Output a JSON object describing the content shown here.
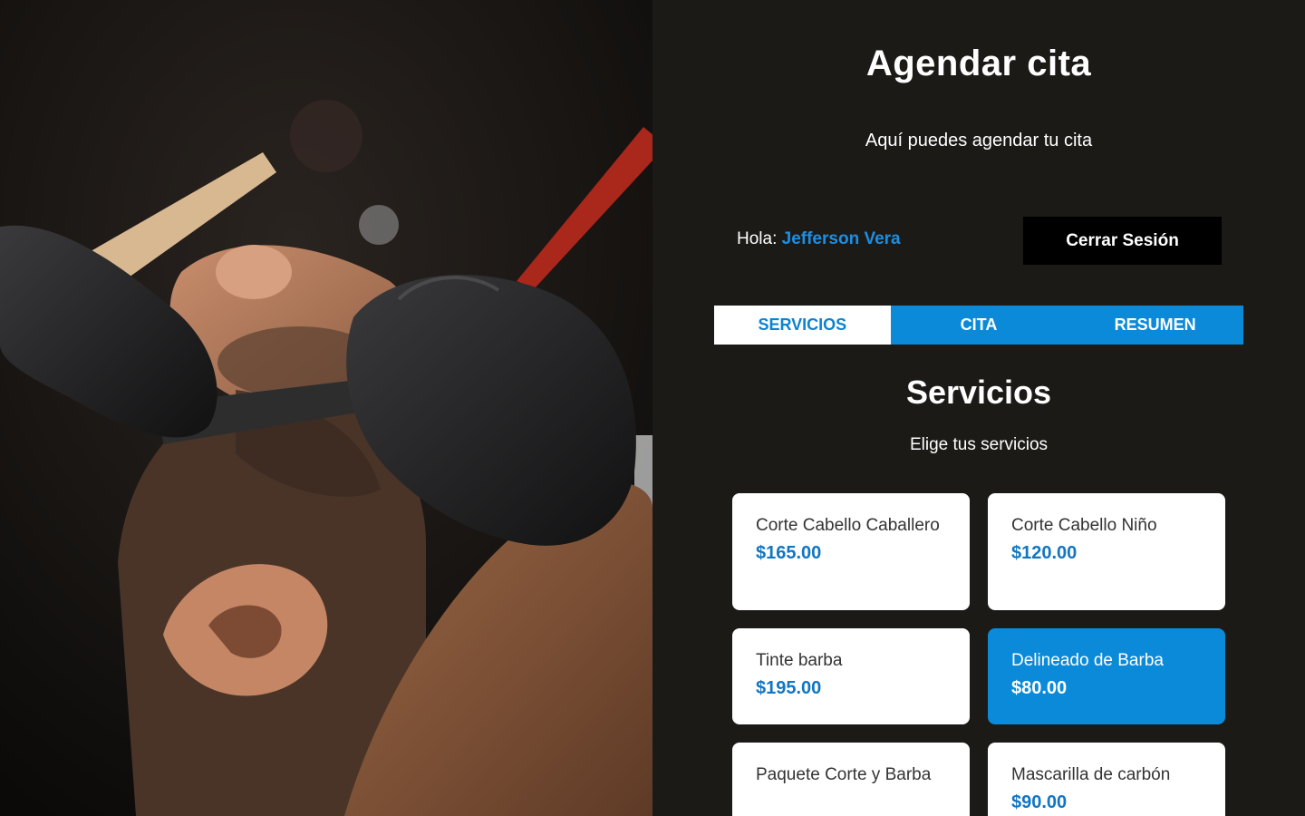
{
  "app": {
    "title": "Agendar cita",
    "subtitle": "Aquí puedes agendar tu cita"
  },
  "user": {
    "greeting_label": "Hola:",
    "name": "Jefferson Vera",
    "logout_label": "Cerrar Sesión"
  },
  "tabs": [
    {
      "label": "Servicios",
      "active": true
    },
    {
      "label": "Cita",
      "active": false
    },
    {
      "label": "Resumen",
      "active": false
    }
  ],
  "section": {
    "title": "Servicios",
    "subtitle": "Elige tus servicios"
  },
  "services": [
    {
      "name": "Corte Cabello Caballero",
      "price": "$165.00",
      "selected": false
    },
    {
      "name": "Corte Cabello Niño",
      "price": "$120.00",
      "selected": false
    },
    {
      "name": "Tinte barba",
      "price": "$195.00",
      "selected": false
    },
    {
      "name": "Delineado de Barba",
      "price": "$80.00",
      "selected": true
    },
    {
      "name": "Paquete Corte y Barba",
      "price": "",
      "selected": false
    },
    {
      "name": "Mascarilla de carbón",
      "price": "$90.00",
      "selected": false
    }
  ],
  "colors": {
    "accent": "#0a8ad8",
    "price": "#1276c2",
    "username": "#1e8ee0",
    "panel_background": "#1b1a17"
  }
}
